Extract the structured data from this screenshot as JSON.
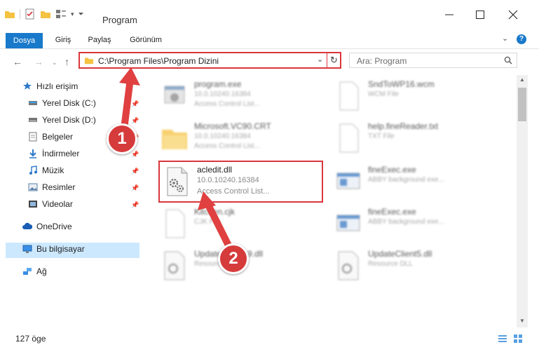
{
  "window": {
    "title": "Program"
  },
  "ribbon": {
    "tabs": [
      "Dosya",
      "Giriş",
      "Paylaş",
      "Görünüm"
    ]
  },
  "address": {
    "path": "C:\\Program Files\\Program Dizini"
  },
  "search": {
    "placeholder": "Ara: Program"
  },
  "sidebar": {
    "items": [
      {
        "label": "Hızlı erişim",
        "icon": "star-icon"
      },
      {
        "label": "Yerel Disk (C:)",
        "icon": "disk-icon"
      },
      {
        "label": "Yerel Disk (D:)",
        "icon": "disk-icon"
      },
      {
        "label": "Belgeler",
        "icon": "documents-icon"
      },
      {
        "label": "İndirmeler",
        "icon": "download-icon"
      },
      {
        "label": "Müzik",
        "icon": "music-icon"
      },
      {
        "label": "Resimler",
        "icon": "pictures-icon"
      },
      {
        "label": "Videolar",
        "icon": "video-icon"
      },
      {
        "label": "OneDrive",
        "icon": "cloud-icon"
      },
      {
        "label": "Bu bilgisayar",
        "icon": "computer-icon"
      },
      {
        "label": "Ağ",
        "icon": "network-icon"
      }
    ]
  },
  "files": [
    {
      "name": "program.exe",
      "line1": "10.0.10240.16384",
      "line2": "Access Control List..."
    },
    {
      "name": "SndToWP16.wcm",
      "line1": "WCM File",
      "line2": ""
    },
    {
      "name": "Microsoft.VC90.CRT",
      "line1": "10.0.10240.16384",
      "line2": "Access Control List..."
    },
    {
      "name": "help.fineReader.txt",
      "line1": "TXT File",
      "line2": ""
    },
    {
      "name": "acledit.dll",
      "line1": "10.0.10240.16384",
      "line2": "Access Control List..."
    },
    {
      "name": "fineExec.exe",
      "line1": "ABBY background exe...",
      "line2": ""
    },
    {
      "name": "Kitchen.cjk",
      "line1": "CJK File",
      "line2": ""
    },
    {
      "name": "fineExec.exe",
      "line1": "ABBY background exe...",
      "line2": ""
    },
    {
      "name": "UpdateClient19.dll",
      "line1": "Resource DLL",
      "line2": ""
    },
    {
      "name": "UpdateClient5.dll",
      "line1": "Resource DLL",
      "line2": ""
    }
  ],
  "status": {
    "count": "127 öge"
  },
  "annotations": {
    "step1": "1",
    "step2": "2"
  },
  "colors": {
    "accent": "#1979ca",
    "highlight": "#d9363b",
    "selected": "#cce8ff"
  }
}
